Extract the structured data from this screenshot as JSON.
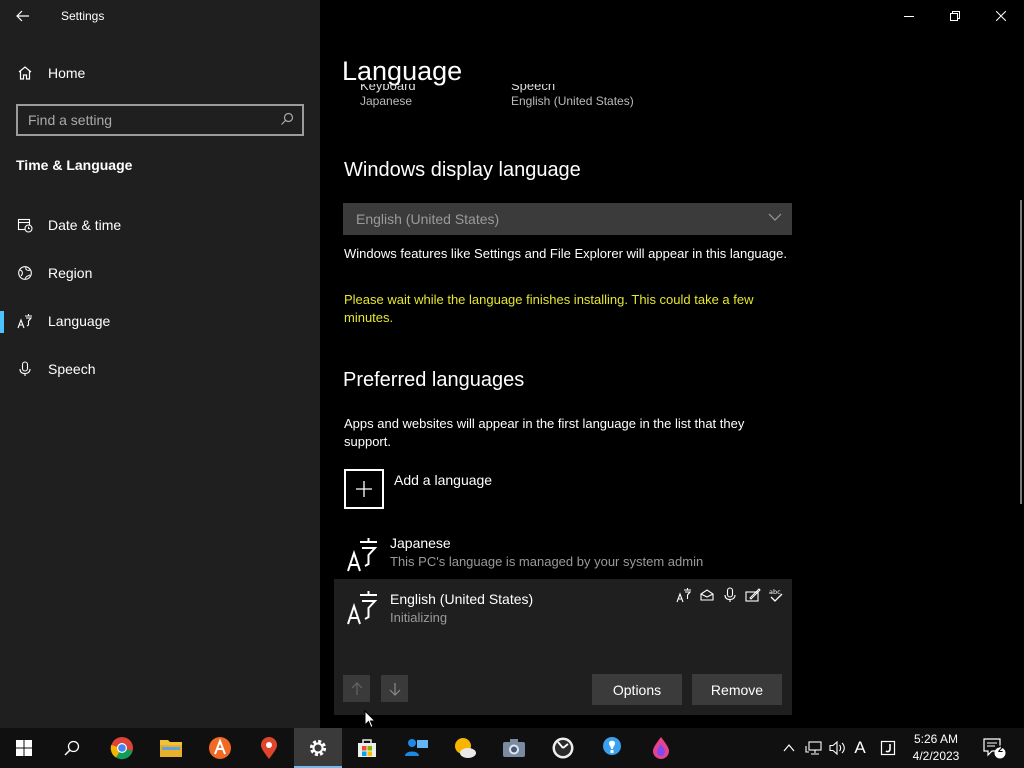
{
  "window": {
    "app_title": "Settings"
  },
  "sidebar": {
    "home_label": "Home",
    "search_placeholder": "Find a setting",
    "section_title": "Time & Language",
    "items": [
      {
        "label": "Date & time",
        "icon": "calendar-clock-icon"
      },
      {
        "label": "Region",
        "icon": "globe-icon"
      },
      {
        "label": "Language",
        "icon": "language-icon",
        "active": true
      },
      {
        "label": "Speech",
        "icon": "microphone-icon"
      }
    ]
  },
  "main": {
    "page_title": "Language",
    "peek": [
      {
        "label": "Keyboard",
        "value": "Japanese"
      },
      {
        "label": "Speech",
        "value": "English (United States)"
      }
    ],
    "display_language": {
      "heading": "Windows display language",
      "selected": "English (United States)",
      "description": "Windows features like Settings and File Explorer will appear in this language.",
      "warning": "Please wait while the language finishes installing. This could take a few minutes."
    },
    "preferred_languages": {
      "heading": "Preferred languages",
      "description": "Apps and websites will appear in the first language in the list that they support.",
      "add_label": "Add a language",
      "languages": [
        {
          "name": "Japanese",
          "status": "This PC's language is managed by your system admin"
        },
        {
          "name": "English (United States)",
          "status": "Initializing"
        }
      ],
      "options_label": "Options",
      "remove_label": "Remove"
    }
  },
  "taskbar": {
    "time": "5:26 AM",
    "date": "4/2/2023",
    "notification_count": "2",
    "ime_label": "A"
  },
  "colors": {
    "accent": "#4cc2ff",
    "warning": "#e6e62e",
    "sidebar_bg": "#1f1f1f"
  }
}
